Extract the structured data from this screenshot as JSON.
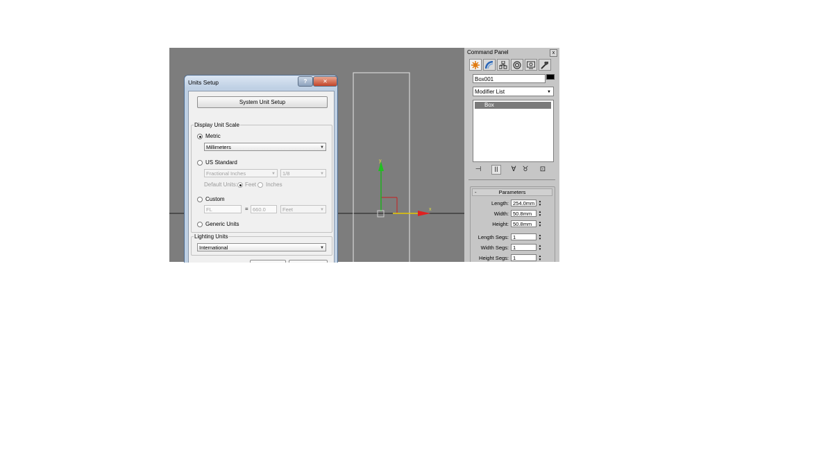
{
  "dialog": {
    "title": "Units Setup",
    "help_label": "?",
    "close_label": "✕",
    "system_unit_button": "System Unit Setup",
    "display_unit_scale": {
      "legend": "Display Unit Scale",
      "metric_label": "Metric",
      "metric_value": "Millimeters",
      "us_standard_label": "US Standard",
      "us_unit_value": "Fractional Inches",
      "us_fraction_value": "1/8",
      "default_units_label": "Default Units:",
      "feet_label": "Feet",
      "inches_label": "Inches",
      "custom_label": "Custom",
      "custom_name": "FL",
      "equals": "=",
      "custom_amount": "660.0",
      "custom_unit": "Feet",
      "generic_label": "Generic Units",
      "selected": "Metric"
    },
    "lighting_units": {
      "legend": "Lighting Units",
      "value": "International"
    }
  },
  "command_panel": {
    "title": "Command Panel",
    "close_label": "x",
    "tabs": [
      {
        "icon": "create-icon",
        "active": true
      },
      {
        "icon": "modify-icon",
        "active": false
      },
      {
        "icon": "hierarchy-icon",
        "active": false
      },
      {
        "icon": "motion-icon",
        "active": false
      },
      {
        "icon": "display-icon",
        "active": false
      },
      {
        "icon": "utilities-icon",
        "active": false
      }
    ],
    "object_name": "Box001",
    "object_color": "#000000",
    "modifier_list": "Modifier List",
    "stack_item": "Box",
    "stack_icons": [
      "pin-stack-icon",
      "show-end-result-icon",
      "make-unique-icon",
      "remove-modifier-icon",
      "configure-modifier-sets-icon"
    ],
    "parameters": {
      "title": "Parameters",
      "collapse_label": "-",
      "rows": [
        {
          "label": "Length:",
          "value": "254.0mm"
        },
        {
          "label": "Width:",
          "value": "50.8mm"
        },
        {
          "label": "Height:",
          "value": "50.8mm"
        },
        {
          "label": "Length Segs:",
          "value": "1"
        },
        {
          "label": "Width Segs:",
          "value": "1"
        },
        {
          "label": "Height Segs:",
          "value": "1"
        }
      ]
    }
  },
  "viewport": {
    "background": "#7d7d7d",
    "axis_labels": {
      "x": "x",
      "y": "y"
    },
    "axis_colors": {
      "x": "#e02020",
      "y": "#20b020",
      "z": "#c82020"
    }
  }
}
